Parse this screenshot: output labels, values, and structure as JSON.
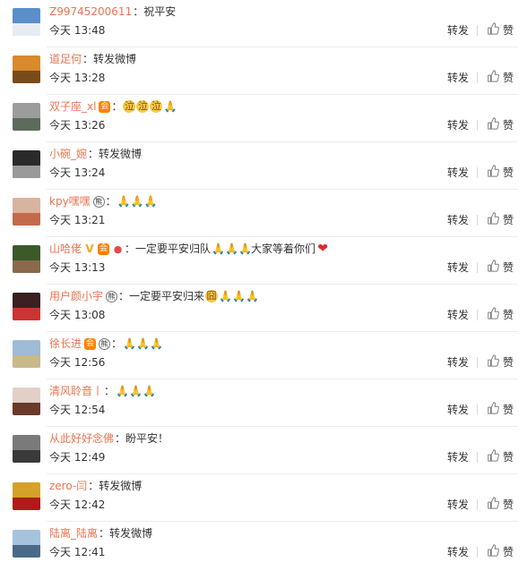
{
  "action_labels": {
    "forward": "转发",
    "like": "赞"
  },
  "comments": [
    {
      "user": "Z99745200611",
      "badges": [],
      "text": "祝平安",
      "time": "今天 13:48",
      "avatar": {
        "bg": "#5b8fc9",
        "fg": "#e7ecf3"
      }
    },
    {
      "user": "道足何",
      "badges": [],
      "text": "转发微博",
      "time": "今天 13:28",
      "avatar": {
        "bg": "#d98a2b",
        "fg": "#7a4b1a"
      }
    },
    {
      "user": "双子座_xl",
      "badges": [
        "vip"
      ],
      "text": "",
      "emojis": [
        "cry",
        "cry",
        "cry",
        "pray"
      ],
      "time": "今天 13:26",
      "avatar": {
        "bg": "#9c9c9c",
        "fg": "#5c6b5c"
      }
    },
    {
      "user": "小碗_婉",
      "badges": [],
      "text": "转发微博",
      "time": "今天 13:24",
      "avatar": {
        "bg": "#2a2a2a",
        "fg": "#9a9a9a"
      }
    },
    {
      "user": "kpy嘿嘿",
      "badges": [
        "panda"
      ],
      "text": "",
      "emojis": [
        "pray",
        "pray",
        "pray"
      ],
      "time": "今天 13:21",
      "avatar": {
        "bg": "#d8b3a0",
        "fg": "#c26a4a"
      }
    },
    {
      "user": "山哈佬",
      "badges": [
        "v",
        "vip",
        "bulb"
      ],
      "text": "一定要平安归队",
      "emojis_after": [
        "pray",
        "pray",
        "pray"
      ],
      "text2": "大家等着你们",
      "emojis_end": [
        "heart"
      ],
      "time": "今天 13:13",
      "avatar": {
        "bg": "#3a5a2a",
        "fg": "#8a6a4a"
      }
    },
    {
      "user": "用户颜小宇",
      "badges": [
        "panda"
      ],
      "text": "一定要平安归来",
      "emojis_after": [
        "sad",
        "pray",
        "pray",
        "pray"
      ],
      "time": "今天 13:08",
      "avatar": {
        "bg": "#3a2020",
        "fg": "#cc3333"
      }
    },
    {
      "user": "徐长进",
      "badges": [
        "vip",
        "panda"
      ],
      "text": "",
      "emojis": [
        "pray",
        "pray",
        "pray"
      ],
      "time": "今天 12:56",
      "avatar": {
        "bg": "#9fbbd6",
        "fg": "#c8b98a"
      }
    },
    {
      "user": "清风聆音丨",
      "badges": [],
      "text": "",
      "emojis": [
        "pray",
        "pray",
        "pray"
      ],
      "time": "今天 12:54",
      "avatar": {
        "bg": "#e2d0c6",
        "fg": "#6a3a2a"
      }
    },
    {
      "user": "从此好好念佛",
      "badges": [],
      "text": "盼平安！",
      "time": "今天 12:49",
      "avatar": {
        "bg": "#7a7a7a",
        "fg": "#3a3a3a"
      }
    },
    {
      "user": "zero-闫",
      "badges": [],
      "text": "转发微博",
      "time": "今天 12:42",
      "avatar": {
        "bg": "#d4a22a",
        "fg": "#b01a1a"
      }
    },
    {
      "user": "陆离_陆离",
      "badges": [],
      "text": "转发微博",
      "time": "今天 12:41",
      "avatar": {
        "bg": "#a6c3de",
        "fg": "#4a6a8a"
      }
    }
  ]
}
